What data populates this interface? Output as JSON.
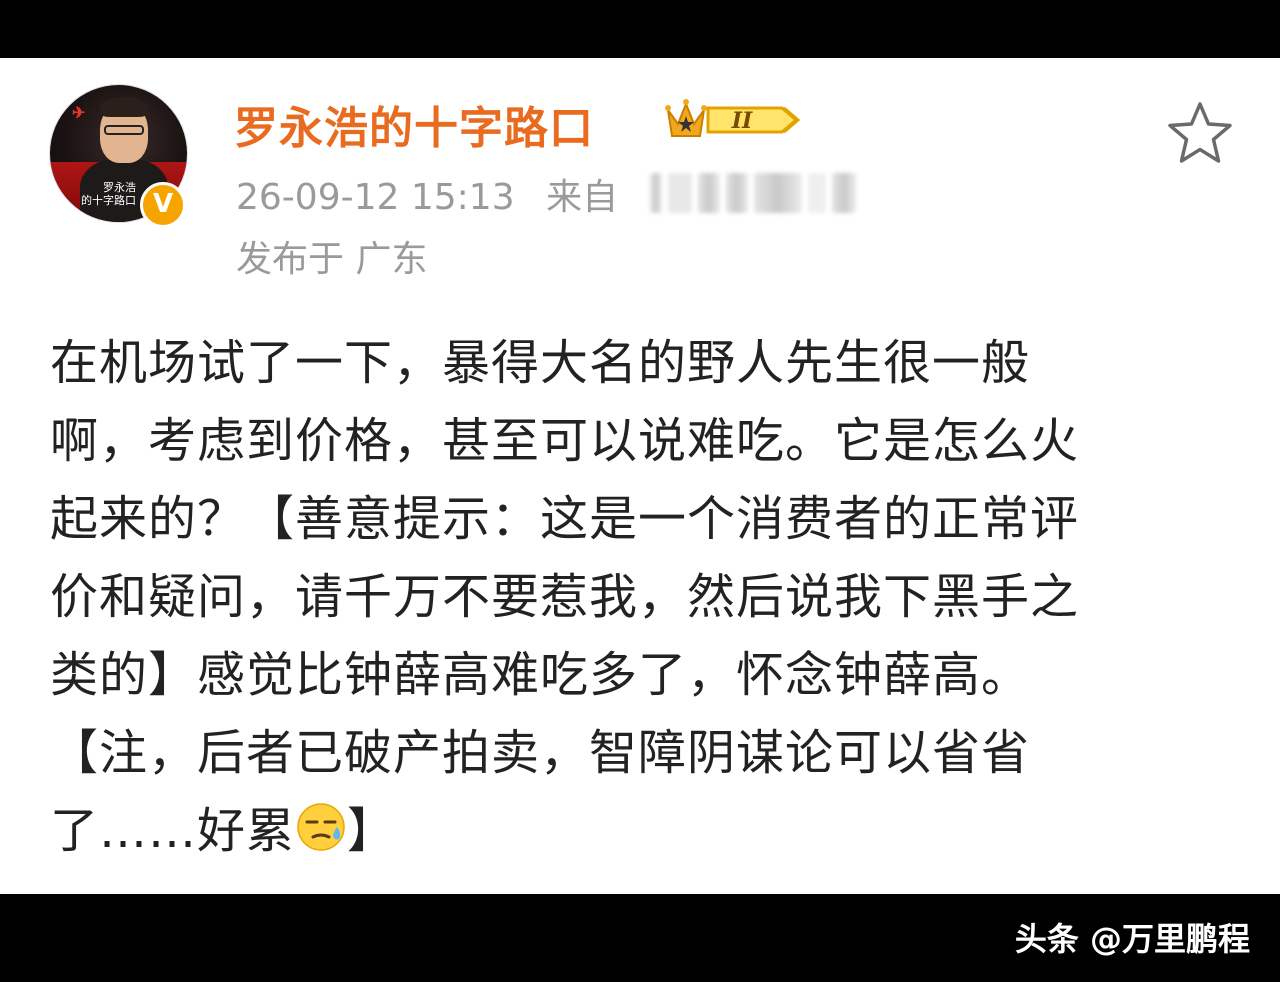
{
  "post": {
    "username": "罗永浩的十字路口",
    "level_badge": "II",
    "timestamp": "26-09-12 15:13",
    "source_prefix": "来自",
    "location": "发布于 广东",
    "avatar_caption_1": "罗永浩",
    "avatar_caption_2": "的十字路口",
    "verified_mark": "V",
    "body_lines": [
      "在机场试了一下，暴得大名的野人先生很一般",
      "啊，考虑到价格，甚至可以说难吃。它是怎么火",
      "起来的？【善意提示：这是一个消费者的正常评",
      "价和疑问，请千万不要惹我，然后说我下黑手之",
      "类的】感觉比钟薛高难吃多了，怀念钟薛高。",
      "【注，后者已破产拍卖，智障阴谋论可以省省",
      "了……好累"
    ],
    "body_tail": "】",
    "emoji": "sweat-face-icon"
  },
  "watermark": {
    "text": "头条 @万里鹏程"
  },
  "colors": {
    "username": "#e86b1f",
    "meta": "#9a9a9a",
    "body": "#222222",
    "verified": "#f6a400",
    "crown": "#f2a81d"
  }
}
